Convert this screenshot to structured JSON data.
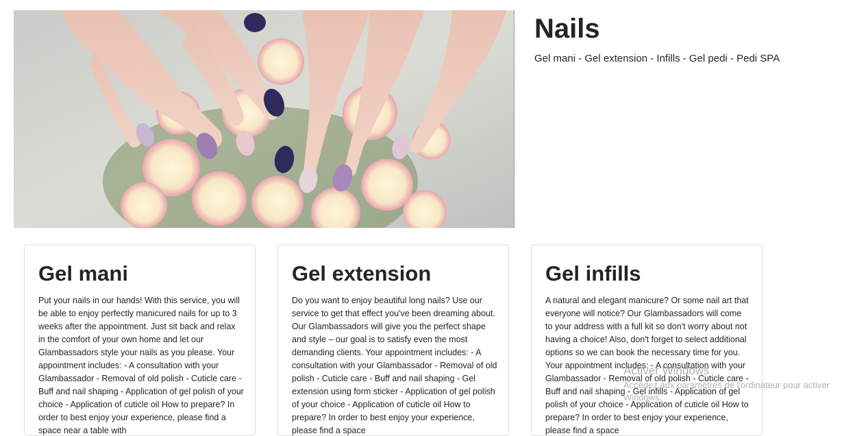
{
  "hero": {
    "title": "Nails",
    "subtitle": "Gel mani - Gel extension - Infills - Gel pedi - Pedi SPA",
    "image_icon": "manicured-hands-with-roses-photo"
  },
  "cards": [
    {
      "title": "Gel mani",
      "text": "Put your nails in our hands! With this service, you will be able to enjoy perfectly manicured nails for up to 3 weeks after the appointment. Just sit back and relax in the comfort of your own home and let our Glambassadors style your nails as you please. Your appointment includes: - A consultation with your Glambassador - Removal of old polish - Cuticle care - Buff and nail shaping - Application of gel polish of your choice - Application of cuticle oil How to prepare? In order to best enjoy your experience, please find a space near a table with"
    },
    {
      "title": "Gel extension",
      "text": "Do you want to enjoy beautiful long nails? Use our service to get that effect you've been dreaming about. Our Glambassadors will give you the perfect shape and style – our goal is to satisfy even the most demanding clients. Your appointment includes: - A consultation with your Glambassador - Removal of old polish - Cuticle care - Buff and nail shaping - Gel extension using form sticker - Application of gel polish of your choice - Application of cuticle oil How to prepare? In order to best enjoy your experience, please find a space"
    },
    {
      "title": "Gel infills",
      "text": "A natural and elegant manicure? Or some nail art that everyone will notice? Our Glambassadors will come to your address with a full kit so don't worry about not having a choice! Also, don't forget to select additional options so we can book the necessary time for you. Your appointment includes: - A consultation with your Glambassador - Removal of old polish - Cuticle care - Buff and nail shaping - Gel infills - Application of gel polish of your choice - Application of cuticle oil How to prepare? In order to best enjoy your experience, please find a space"
    }
  ],
  "watermark": {
    "line1": "Activer Windows",
    "line2": "Accédez aux paramètres de l'ordinateur pour activer Windows."
  }
}
